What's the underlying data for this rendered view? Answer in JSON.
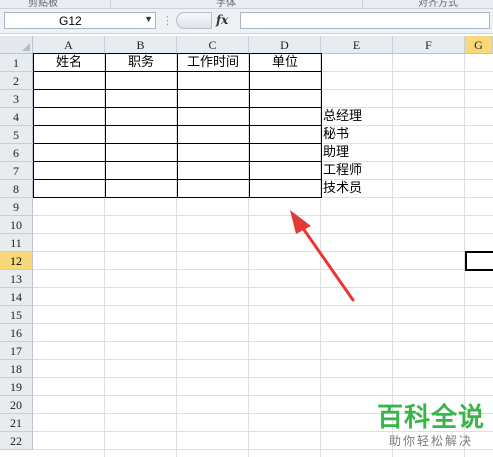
{
  "ribbon": {
    "groups": [
      "剪贴板",
      "字体",
      "对齐方式"
    ]
  },
  "formula_bar": {
    "name_box": "G12",
    "fx_label": "fx",
    "formula": ""
  },
  "columns": [
    "A",
    "B",
    "C",
    "D",
    "E",
    "F"
  ],
  "rows": [
    "1",
    "2",
    "3",
    "4",
    "5",
    "6",
    "7",
    "8",
    "9",
    "10",
    "11",
    "12",
    "13",
    "14",
    "15",
    "16",
    "17",
    "18",
    "19",
    "20",
    "21",
    "22"
  ],
  "selected_cell": {
    "column": "G",
    "row": "12"
  },
  "table": {
    "headers": [
      "姓名",
      "职务",
      "工作时间",
      "单位"
    ]
  },
  "column_e": {
    "values": [
      "总经理",
      "秘书",
      "助理",
      "工程师",
      "技术员"
    ]
  },
  "watermark": {
    "title": "百科全说",
    "subtitle": "助你轻松解决"
  },
  "colors": {
    "selected_header": "#f9d87a",
    "watermark_green": "#39b54a",
    "arrow": "#e53935"
  }
}
